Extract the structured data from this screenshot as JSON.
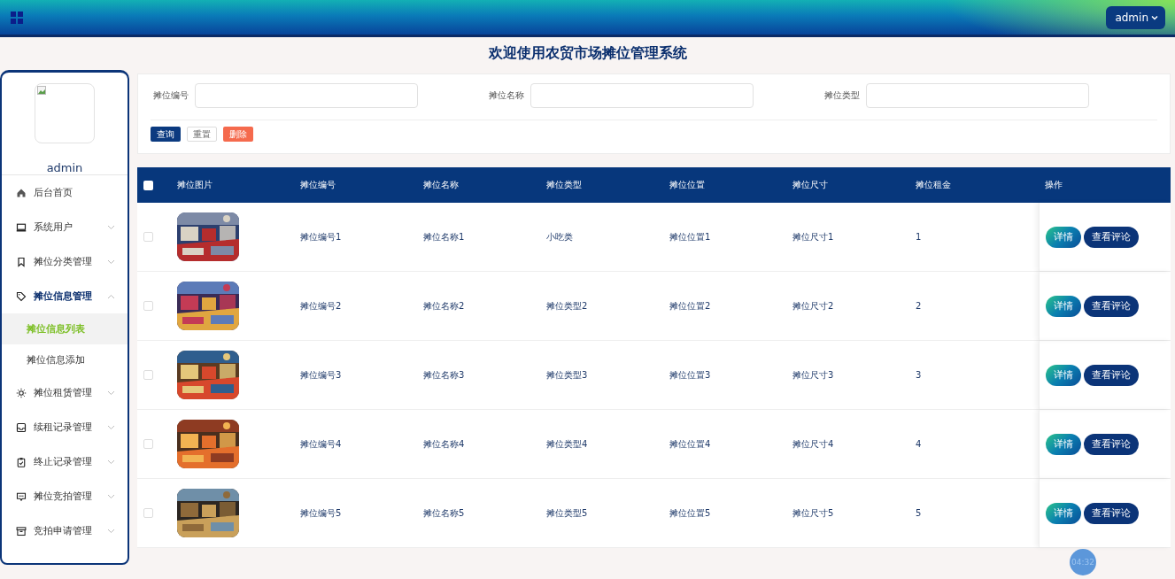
{
  "header": {
    "user_menu": "admin"
  },
  "page_title": "欢迎使用农贸市场摊位管理系统",
  "sidebar": {
    "user_name": "admin",
    "items": [
      {
        "label": "后台首页",
        "kind": "link"
      },
      {
        "label": "系统用户",
        "kind": "menu",
        "expanded": false
      },
      {
        "label": "摊位分类管理",
        "kind": "menu",
        "expanded": false
      },
      {
        "label": "摊位信息管理",
        "kind": "menu",
        "expanded": true,
        "children": [
          {
            "label": "摊位信息列表",
            "selected": true
          },
          {
            "label": "摊位信息添加",
            "selected": false
          }
        ]
      },
      {
        "label": "摊位租赁管理",
        "kind": "menu",
        "expanded": false
      },
      {
        "label": "续租记录管理",
        "kind": "menu",
        "expanded": false
      },
      {
        "label": "终止记录管理",
        "kind": "menu",
        "expanded": false
      },
      {
        "label": "摊位竞拍管理",
        "kind": "menu",
        "expanded": false
      },
      {
        "label": "竞拍申请管理",
        "kind": "menu",
        "expanded": false
      }
    ]
  },
  "search": {
    "fields": [
      {
        "label": "摊位编号"
      },
      {
        "label": "摊位名称"
      },
      {
        "label": "摊位类型"
      }
    ],
    "buttons": [
      {
        "label": "查询",
        "kind": "primary"
      },
      {
        "label": "重置",
        "kind": "default"
      },
      {
        "label": "删除",
        "kind": "danger"
      }
    ]
  },
  "table": {
    "select_all_checked": false,
    "picture_column": "摊位图片",
    "columns": [
      "摊位编号",
      "摊位名称",
      "摊位类型",
      "摊位位置",
      "摊位尺寸",
      "摊位租金",
      "操作"
    ],
    "rows": [
      {
        "checked": false,
        "picture": {
          "kind": "picture"
        },
        "cells": [
          "摊位编号1",
          "摊位名称1",
          "小吃类",
          "摊位位置1",
          "摊位尺寸1",
          "1"
        ],
        "actions": [
          "详情",
          "查看评论"
        ]
      },
      {
        "checked": false,
        "picture": {
          "kind": "picture"
        },
        "cells": [
          "摊位编号2",
          "摊位名称2",
          "摊位类型2",
          "摊位位置2",
          "摊位尺寸2",
          "2"
        ],
        "actions": [
          "详情",
          "查看评论"
        ]
      },
      {
        "checked": false,
        "picture": {
          "kind": "picture"
        },
        "cells": [
          "摊位编号3",
          "摊位名称3",
          "摊位类型3",
          "摊位位置3",
          "摊位尺寸3",
          "3"
        ],
        "actions": [
          "详情",
          "查看评论"
        ]
      },
      {
        "checked": false,
        "picture": {
          "kind": "picture"
        },
        "cells": [
          "摊位编号4",
          "摊位名称4",
          "摊位类型4",
          "摊位位置4",
          "摊位尺寸4",
          "4"
        ],
        "actions": [
          "详情",
          "查看评论"
        ]
      },
      {
        "checked": false,
        "picture": {
          "kind": "picture"
        },
        "cells": [
          "摊位编号5",
          "摊位名称5",
          "摊位类型5",
          "摊位位置5",
          "摊位尺寸5",
          "5"
        ],
        "actions": [
          "详情",
          "查看评论"
        ]
      }
    ]
  },
  "video_timer": "04:32"
}
